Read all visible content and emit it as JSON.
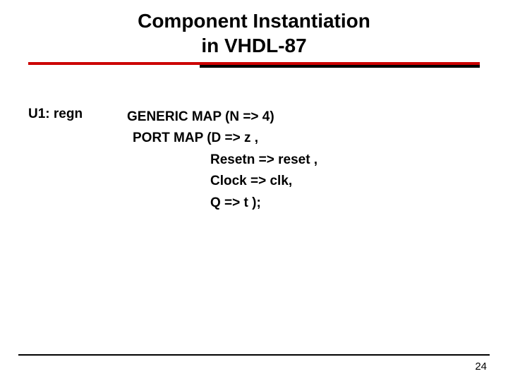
{
  "slide": {
    "title_line1": "Component Instantiation",
    "title_line2": "in VHDL-87",
    "instance_label": "U1: regn",
    "code": {
      "generic_map": "GENERIC MAP (N => 4)",
      "port_map_open": "PORT MAP (D => z ,",
      "resetn": "Resetn => reset ,",
      "clock": "Clock => clk,",
      "q": "Q => t );"
    },
    "page_number": "24"
  },
  "colors": {
    "underline_primary": "#cc0000",
    "underline_secondary": "#000000"
  }
}
